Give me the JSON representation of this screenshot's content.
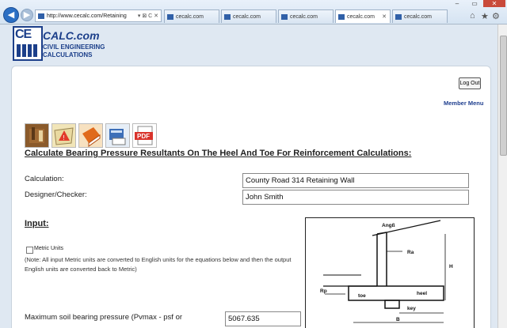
{
  "browser": {
    "url": "http://www.cecalc.com/Retaining",
    "address_controls": "▾ ⊠ C ✕",
    "tabs": [
      {
        "label": "cecalc.com"
      },
      {
        "label": "cecalc.com"
      },
      {
        "label": "cecalc.com"
      },
      {
        "label": "cecalc.com"
      },
      {
        "label": "cecalc.com"
      }
    ],
    "tab_close": "✕",
    "window_controls": {
      "minimize": "–",
      "maximize": "▭",
      "close": "✕"
    },
    "toolbar_icons": [
      "home-icon",
      "star-icon",
      "gear-icon"
    ]
  },
  "logo": {
    "mark": "CE",
    "title": "CALC.com",
    "subtitle": "CIVIL ENGINEERING CALCULATIONS"
  },
  "header": {
    "logout_label": "Log Out",
    "member_menu_label": "Member Menu"
  },
  "icons": [
    "toolbox-icon",
    "warning-map-icon",
    "book-icon",
    "calculator-print-icon",
    "pdf-icon"
  ],
  "pdf_label": "PDF",
  "page": {
    "heading": "Calculate Bearing Pressure Resultants On The Heel And Toe For Reinforcement Calculations:",
    "calculation_label": "Calculation:",
    "calculation_value": "County Road 314 Retaining Wall",
    "designer_label": "Designer/Checker:",
    "designer_value": "John Smith",
    "input_heading": "Input:",
    "metric_label": "Metric Units",
    "note": "(Note: All input Metric units are converted to English units for the equations below and then the output English units are converted back to Metric)",
    "soil_label": "Maximum soil bearing pressure (Pvmax - psf or",
    "soil_value": "5067.635"
  },
  "diagram": {
    "labels": {
      "angle": "Angß",
      "ra": "Ra",
      "h": "H",
      "rp": "Rp",
      "toe": "toe",
      "heel": "heel",
      "key": "key",
      "b": "B"
    }
  },
  "colors": {
    "brand": "#1c3f8a",
    "link": "#1f3f8f",
    "pdf_red": "#d9332b"
  }
}
